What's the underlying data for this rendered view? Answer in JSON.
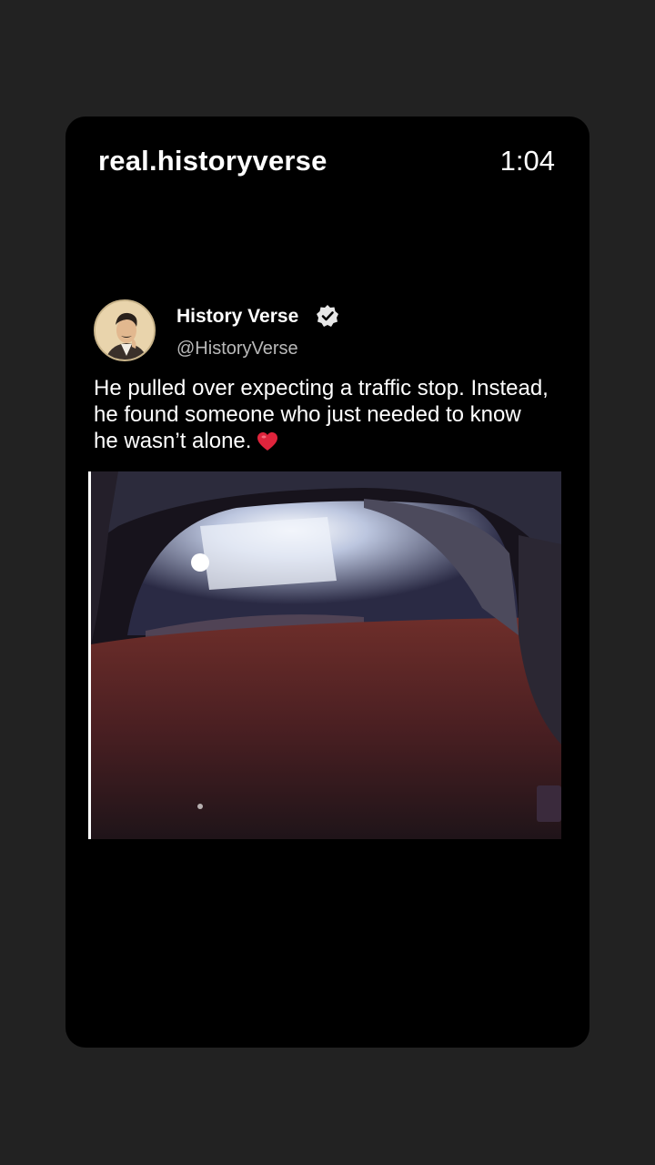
{
  "header": {
    "account_name": "real.historyverse",
    "timestamp": "1:04"
  },
  "post": {
    "author_name": "History Verse",
    "author_handle": "@HistoryVerse",
    "text": "He pulled over expecting a traffic stop. Instead, he found someone who just needed to know he wasn’t alone.",
    "emoji": "heart-icon"
  },
  "colors": {
    "page_background": "#222222",
    "card_background": "#000000",
    "handle_gray": "#b9b9b9",
    "heart_red": "#e0243c"
  }
}
